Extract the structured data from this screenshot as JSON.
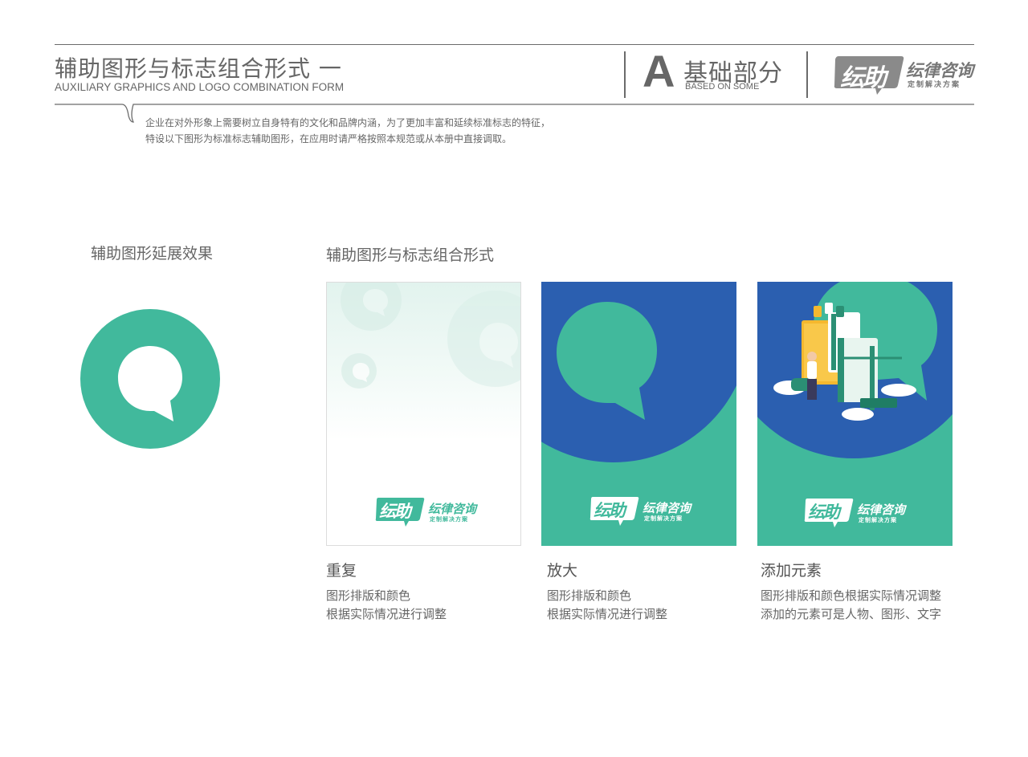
{
  "header": {
    "title_cn": "辅助图形与标志组合形式 一",
    "title_en": "AUXILIARY GRAPHICS AND LOGO COMBINATION FORM",
    "section_letter": "A",
    "section_cn": "基础部分",
    "section_en": "BASED ON SOME",
    "brand": {
      "mark": "纭助",
      "name": "纭律咨询",
      "tagline": "定制解决方案"
    }
  },
  "description": {
    "line1": "企业在对外形象上需要树立自身特有的文化和品牌内涵，为了更加丰富和延续标准标志的特征，",
    "line2": "特设以下图形为标准标志辅助图形，在应用时请严格按照本规范或从本册中直接调取。"
  },
  "left_section": {
    "heading": "辅助图形延展效果"
  },
  "right_section": {
    "heading": "辅助图形与标志组合形式"
  },
  "cards": [
    {
      "caption": "重复",
      "lines": [
        "图形排版和颜色",
        "根据实际情况进行调整"
      ],
      "logo_mark": "纭助",
      "logo_name": "纭律咨询",
      "logo_tagline": "定制解决方案"
    },
    {
      "caption": "放大",
      "lines": [
        "图形排版和颜色",
        "根据实际情况进行调整"
      ],
      "logo_mark": "纭助",
      "logo_name": "纭律咨询",
      "logo_tagline": "定制解决方案"
    },
    {
      "caption": "添加元素",
      "lines": [
        "图形排版和颜色根据实际情况调整",
        "添加的元素可是人物、图形、文字"
      ],
      "logo_mark": "纭助",
      "logo_name": "纭律咨询",
      "logo_tagline": "定制解决方案"
    }
  ],
  "colors": {
    "brand_green": "#41b99c",
    "brand_blue": "#2b5fb0",
    "text_gray": "#666666",
    "rule_gray": "#6b6b6b"
  }
}
